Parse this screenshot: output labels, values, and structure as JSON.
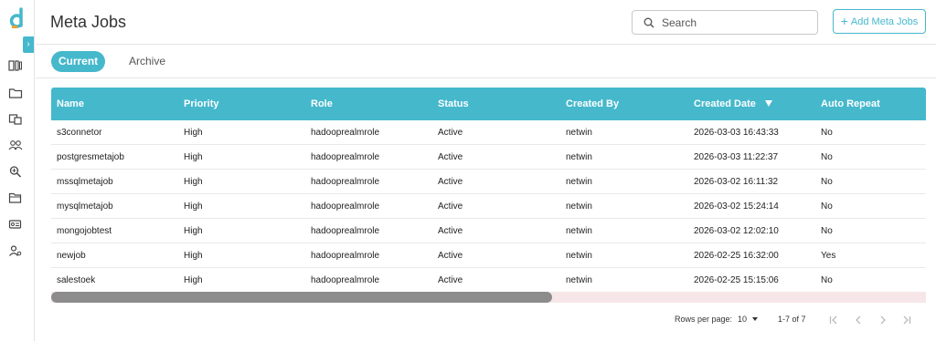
{
  "sidebar": {
    "logo_icon": "d-logo-icon",
    "collapse_icon": "chevron-right-icon",
    "collapse_glyph": "›",
    "items": [
      {
        "icon": "columns-icon"
      },
      {
        "icon": "folder-icon"
      },
      {
        "icon": "tag-stack-icon"
      },
      {
        "icon": "users-icon"
      },
      {
        "icon": "zoom-icon"
      },
      {
        "icon": "folder-open-icon"
      },
      {
        "icon": "id-card-icon"
      },
      {
        "icon": "user-settings-icon"
      }
    ]
  },
  "header": {
    "title": "Meta Jobs",
    "search_placeholder": "Search",
    "add_button_label": "Add Meta Jobs",
    "add_button_glyph": "+"
  },
  "tabs": [
    {
      "label": "Current",
      "active": true
    },
    {
      "label": "Archive",
      "active": false
    }
  ],
  "table": {
    "columns": [
      "Name",
      "Priority",
      "Role",
      "Status",
      "Created By",
      "Created Date",
      "Auto Repeat"
    ],
    "sort_column": "Created Date",
    "sort_direction": "desc",
    "rows": [
      [
        "s3connetor",
        "High",
        "hadooprealmrole",
        "Active",
        "netwin",
        "2026-03-03 16:43:33",
        "No"
      ],
      [
        "postgresmetajob",
        "High",
        "hadooprealmrole",
        "Active",
        "netwin",
        "2026-03-03 11:22:37",
        "No"
      ],
      [
        "mssqlmetajob",
        "High",
        "hadooprealmrole",
        "Active",
        "netwin",
        "2026-03-02 16:11:32",
        "No"
      ],
      [
        "mysqlmetajob",
        "High",
        "hadooprealmrole",
        "Active",
        "netwin",
        "2026-03-02 15:24:14",
        "No"
      ],
      [
        "mongojobtest",
        "High",
        "hadooprealmrole",
        "Active",
        "netwin",
        "2026-03-02 12:02:10",
        "No"
      ],
      [
        "newjob",
        "High",
        "hadooprealmrole",
        "Active",
        "netwin",
        "2026-02-25 16:32:00",
        "Yes"
      ],
      [
        "salestoek",
        "High",
        "hadooprealmrole",
        "Active",
        "netwin",
        "2026-02-25 15:15:06",
        "No"
      ]
    ]
  },
  "pagination": {
    "rows_per_page_label": "Rows per page:",
    "rows_per_page_value": "10",
    "range_label": "1-7 of 7"
  },
  "colors": {
    "accent": "#45b8cc",
    "scroll_track": "#f7e6e8",
    "scroll_thumb": "#8c8c8c"
  }
}
